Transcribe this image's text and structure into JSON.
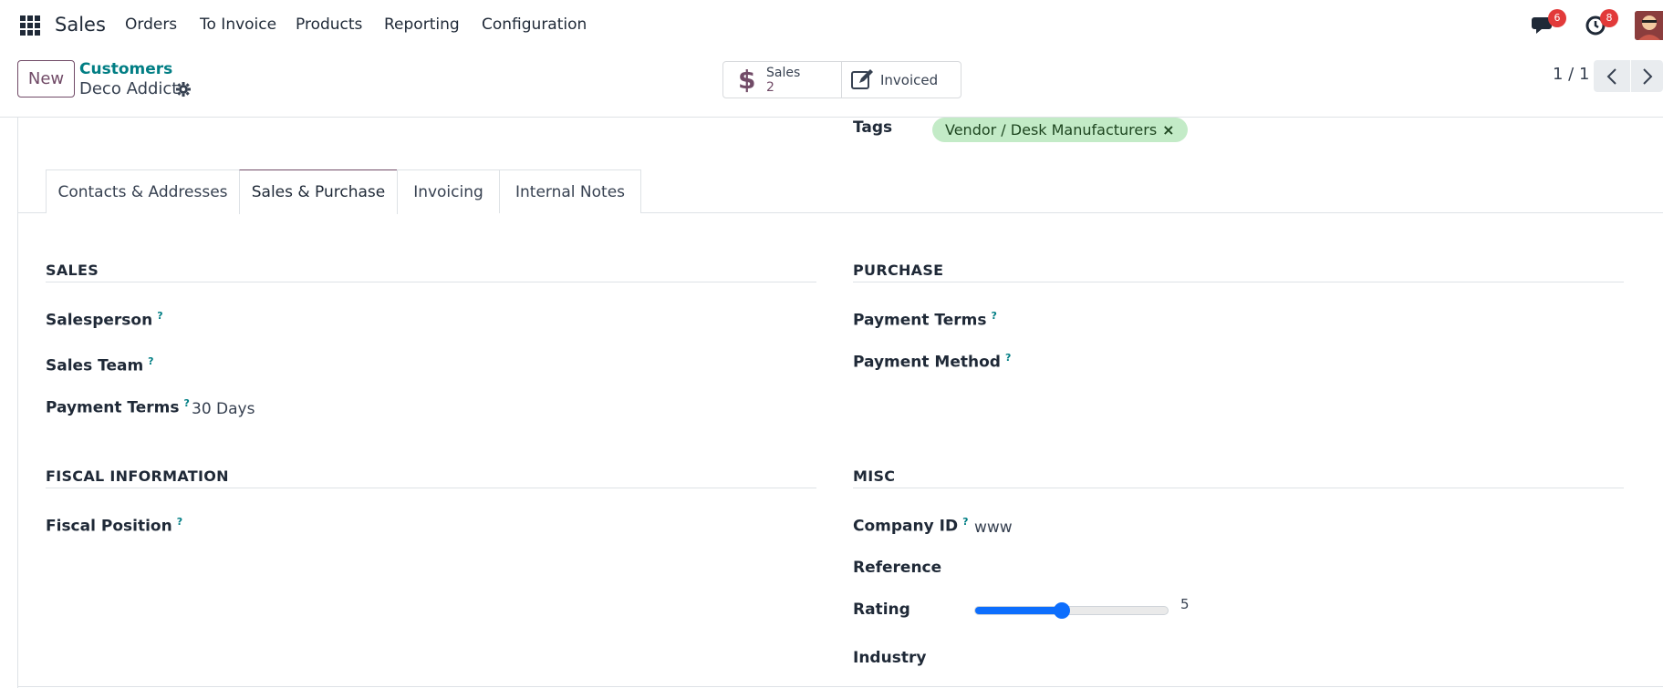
{
  "navbar": {
    "app_name": "Sales",
    "menu": [
      "Orders",
      "To Invoice",
      "Products",
      "Reporting",
      "Configuration"
    ],
    "messages_badge": "6",
    "activities_badge": "8",
    "icons": [
      "apps-grid-icon",
      "chat-icon",
      "clock-icon",
      "user-avatar"
    ]
  },
  "control_panel": {
    "new_label": "New",
    "breadcrumb_parent": "Customers",
    "breadcrumb_current": "Deco Addict",
    "smart_sales_label": "Sales",
    "smart_sales_value": "2",
    "smart_invoiced_label": "Invoiced",
    "pager": "1 / 1"
  },
  "form": {
    "tags_label": "Tags",
    "tag": "Vendor / Desk Manufacturers",
    "tag_remove": "×",
    "tabs": [
      "Contacts & Addresses",
      "Sales & Purchase",
      "Invoicing",
      "Internal Notes"
    ],
    "active_tab": "Sales & Purchase",
    "sales": {
      "title": "SALES",
      "salesperson_label": "Salesperson",
      "sales_team_label": "Sales Team",
      "payment_terms_label": "Payment Terms",
      "payment_terms_value": "30 Days"
    },
    "purchase": {
      "title": "PURCHASE",
      "payment_terms_label": "Payment Terms",
      "payment_method_label": "Payment Method"
    },
    "fiscal": {
      "title": "FISCAL INFORMATION",
      "fiscal_position_label": "Fiscal Position"
    },
    "misc": {
      "title": "MISC",
      "company_id_label": "Company ID",
      "company_id_value": "www",
      "reference_label": "Reference",
      "rating_label": "Rating",
      "rating_value": "5",
      "rating_fraction": 0.45,
      "industry_label": "Industry"
    },
    "help_mark": "?"
  },
  "colors": {
    "brand": "#714b67",
    "link": "#017e84",
    "tag_bg": "#c3ebc7",
    "badge": "#e23a3a",
    "slider": "#0d6efd"
  }
}
